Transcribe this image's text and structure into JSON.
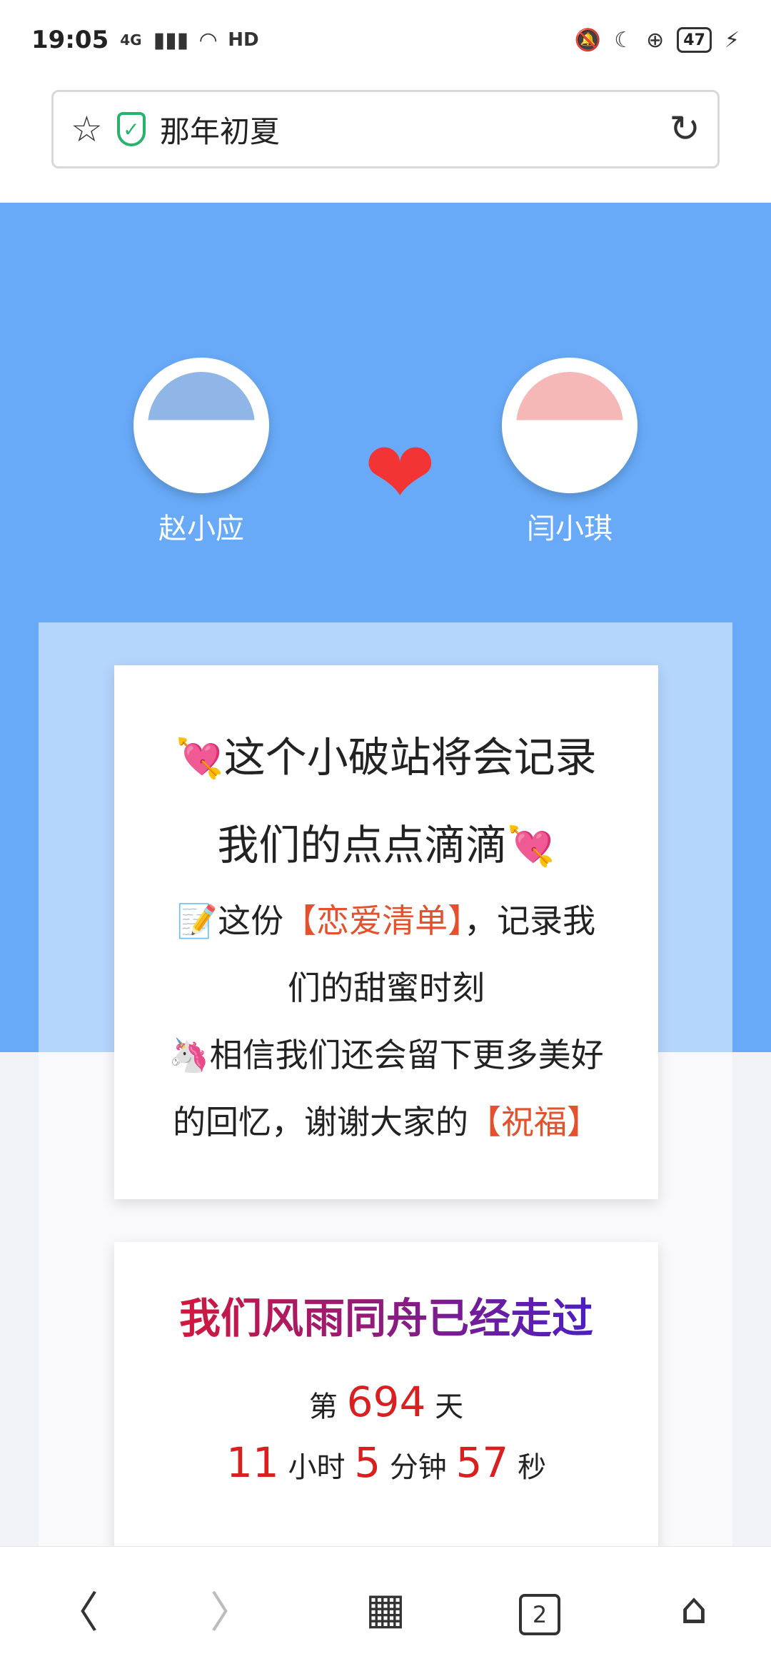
{
  "status": {
    "time": "19:05",
    "network": "4G",
    "hd": "HD",
    "battery": "47"
  },
  "address": {
    "title": "那年初夏"
  },
  "hero": {
    "left_name": "赵小应",
    "right_name": "闫小琪",
    "colors": {
      "hero_bg": "#68aaf8",
      "heart": "#f23434"
    }
  },
  "card1": {
    "line1": "这个小破站将会记录",
    "line2": "我们的点点滴滴",
    "line3_prefix": "这份",
    "line3_highlight": "【恋爱清单】",
    "line3_suffix": "，记录我",
    "line4": "们的甜蜜时刻",
    "line5": "相信我们还会留下更多美好",
    "line6_prefix": "的回忆，谢谢大家的",
    "line6_highlight": "【祝福】"
  },
  "card2": {
    "title": "我们风雨同舟已经走过",
    "day_prefix": "第",
    "days": "694",
    "day_suffix": "天",
    "hours": "11",
    "hours_label": "小时",
    "minutes": "5",
    "minutes_label": "分钟",
    "seconds": "57",
    "seconds_label": "秒"
  },
  "nav": {
    "tabs_count": "2"
  },
  "icons": {
    "star": "star-icon",
    "shield": "shield-icon",
    "reload": "reload-icon",
    "back": "back-icon",
    "forward": "forward-icon",
    "menu": "grid-menu-icon",
    "tabs": "tabs-icon",
    "home": "home-icon"
  }
}
